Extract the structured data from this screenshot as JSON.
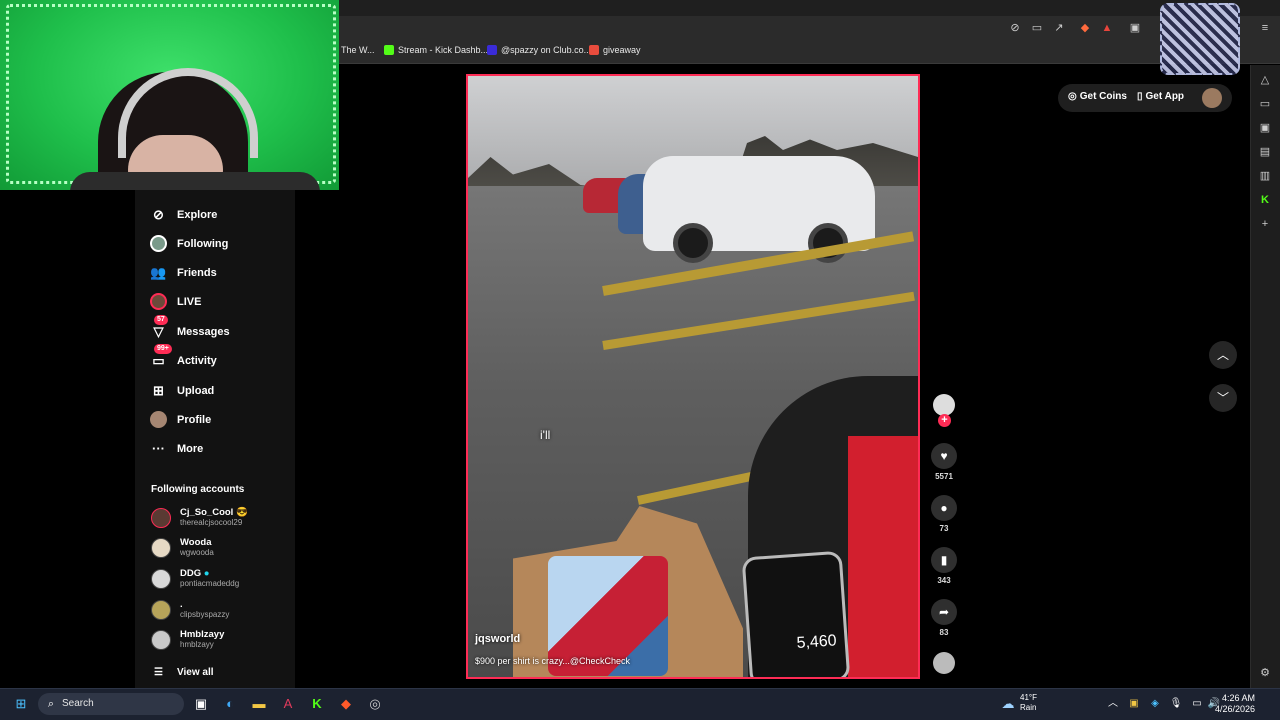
{
  "bookmarks": [
    {
      "label": "The W...",
      "color": "#3a3a3a"
    },
    {
      "label": "Stream - Kick Dashb...",
      "color": "#53fc18"
    },
    {
      "label": "@spazzy on Club.co...",
      "color": "#3a2bd8"
    },
    {
      "label": "giveaway",
      "color": "#e84c3d"
    }
  ],
  "sidebar": {
    "nav": [
      {
        "label": "Explore",
        "icon": "compass-icon"
      },
      {
        "label": "Following",
        "icon": "following-avatar-icon"
      },
      {
        "label": "Friends",
        "icon": "friends-icon"
      },
      {
        "label": "LIVE",
        "icon": "live-avatar-icon"
      },
      {
        "label": "Messages",
        "icon": "messages-icon",
        "badge": "57"
      },
      {
        "label": "Activity",
        "icon": "activity-icon",
        "badge": "99+"
      },
      {
        "label": "Upload",
        "icon": "upload-icon"
      },
      {
        "label": "Profile",
        "icon": "profile-avatar-icon"
      },
      {
        "label": "More",
        "icon": "more-icon"
      }
    ],
    "following_title": "Following accounts",
    "accounts": [
      {
        "name": "Cj_So_Cool 😎",
        "handle": "therealcjsocool29"
      },
      {
        "name": "Wooda",
        "handle": "wgwooda"
      },
      {
        "name": "DDG",
        "handle": "pontiacmadeddg"
      },
      {
        "name": ".",
        "handle": "clipsbyspazzy"
      },
      {
        "name": "Hmblzayy",
        "handle": "hmblzayy"
      }
    ],
    "view_all": "View all"
  },
  "video": {
    "caption_word": "i'll",
    "username": "jqsworld",
    "description": "$900 per shirt is crazy...@CheckCheck",
    "phone_display": "5,460"
  },
  "actions": {
    "likes": "5571",
    "comments": "73",
    "saves": "343",
    "shares": "83"
  },
  "topbar": {
    "get_coins": "Get Coins",
    "get_app": "Get App"
  },
  "taskbar": {
    "search_placeholder": "Search",
    "temperature": "41°F",
    "weather": "Rain",
    "time": "4:26 AM",
    "date": "4/26/2026"
  },
  "colors": {
    "accent": "#fe2c55",
    "kick_green": "#53fc18"
  }
}
